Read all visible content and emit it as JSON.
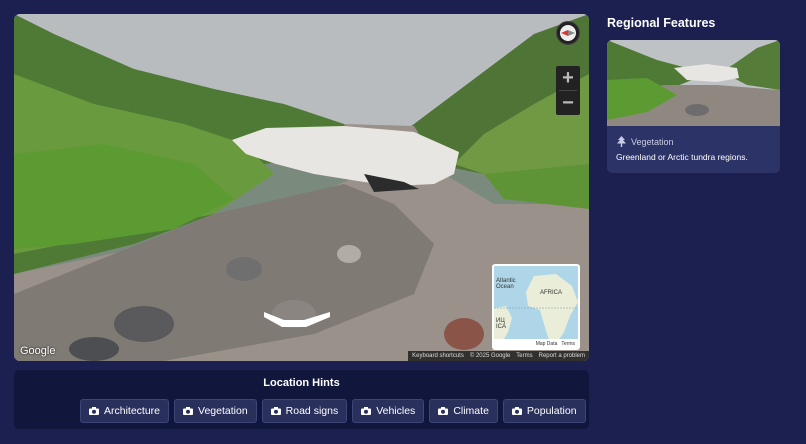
{
  "street_view": {
    "google_logo": "Google",
    "attribution": {
      "keyboard": "Keyboard shortcuts",
      "copyright": "© 2025 Google",
      "terms": "Terms",
      "report": "Report a problem"
    },
    "zoom_in": "+",
    "zoom_out": "−",
    "minimap": {
      "label_ocean": "Atlantic Ocean",
      "label_africa": "AFRICA",
      "label_sa": "ИЦ ICA",
      "map_data": "Map Data",
      "terms": "Terms"
    }
  },
  "hints": {
    "title": "Location Hints",
    "buttons": [
      "Architecture",
      "Vegetation",
      "Road signs",
      "Vehicles",
      "Climate",
      "Population"
    ]
  },
  "regional": {
    "title": "Regional Features",
    "card": {
      "category": "Vegetation",
      "description": "Greenland or Arctic tundra regions."
    }
  }
}
